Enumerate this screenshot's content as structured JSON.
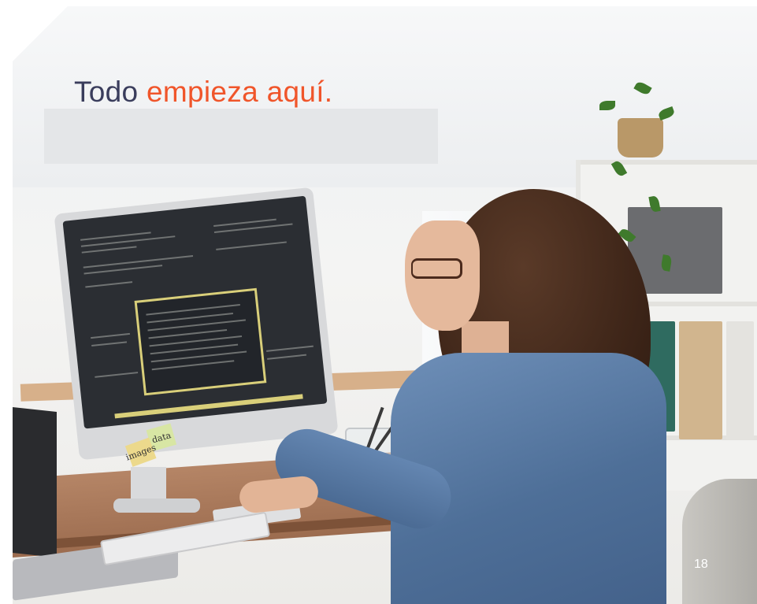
{
  "headline": {
    "part1": "Todo",
    "part2": "empieza aquí."
  },
  "monitor_stickies": [
    "data",
    "images"
  ],
  "page_number": "18",
  "colors": {
    "headline_dark": "#3a3d5c",
    "headline_accent": "#f0552a"
  }
}
